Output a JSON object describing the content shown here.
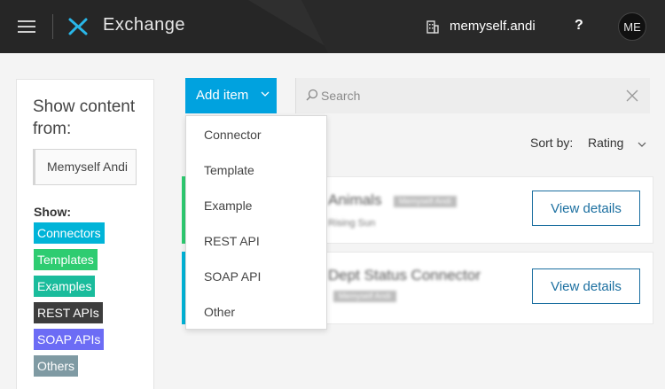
{
  "header": {
    "app_title": "Exchange",
    "org_name": "memyself.andi",
    "help_label": "?",
    "avatar_initials": "ME"
  },
  "sidebar": {
    "show_content_label": "Show content from:",
    "selected_source": "Memyself Andi",
    "show_label": "Show:",
    "filters": [
      {
        "label": "Connectors",
        "color": "#00b4d8"
      },
      {
        "label": "Templates",
        "color": "#2ecc71"
      },
      {
        "label": "Examples",
        "color": "#1abc9c"
      },
      {
        "label": "REST APIs",
        "color": "#3d3d3d"
      },
      {
        "label": "SOAP APIs",
        "color": "#6c6cf5"
      },
      {
        "label": "Others",
        "color": "#7f9aa3"
      }
    ]
  },
  "toolbar": {
    "add_item_label": "Add item",
    "search_placeholder": "Search",
    "sort_label": "Sort by:",
    "sort_value": "Rating"
  },
  "add_menu": {
    "items": [
      "Connector",
      "Template",
      "Example",
      "REST API",
      "SOAP API",
      "Other"
    ]
  },
  "results": [
    {
      "title": "Animals",
      "tag": "Memyself Andi",
      "subtitle": "Rising Sun",
      "accent": "#2ecc71",
      "button": "View details"
    },
    {
      "title": "Dept Status Connector",
      "tag": "Memyself Andi",
      "subtitle": "",
      "accent": "#00b4d8",
      "button": "View details"
    }
  ]
}
